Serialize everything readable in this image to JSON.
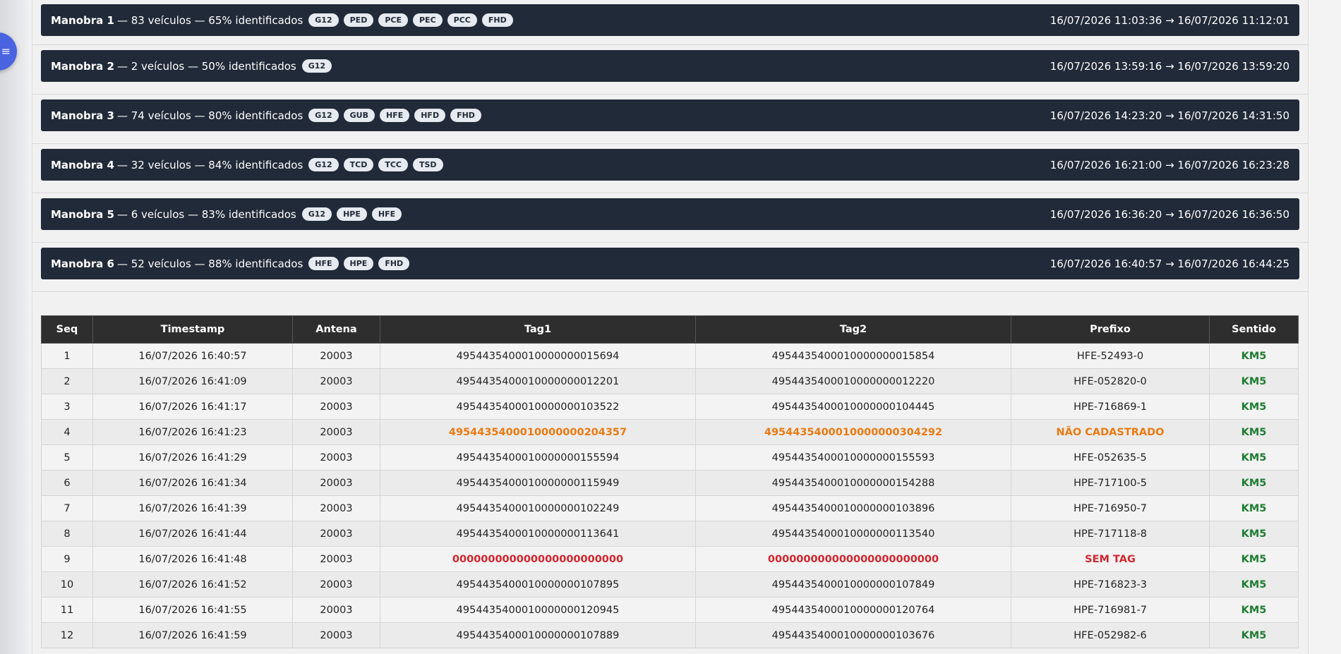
{
  "fab": {
    "icon": "menu-icon",
    "glyph": "≡"
  },
  "manobras": [
    {
      "name": "Manobra 1",
      "info": "— 83 veículos — 65% identificados",
      "tags": [
        "G12",
        "PED",
        "PCE",
        "PEC",
        "PCC",
        "FHD"
      ],
      "period": "16/07/2026 11:03:36 → 16/07/2026 11:12:01"
    },
    {
      "name": "Manobra 2",
      "info": "— 2 veículos — 50% identificados",
      "tags": [
        "G12"
      ],
      "period": "16/07/2026 13:59:16 → 16/07/2026 13:59:20"
    },
    {
      "name": "Manobra 3",
      "info": "— 74 veículos — 80% identificados",
      "tags": [
        "G12",
        "GUB",
        "HFE",
        "HFD",
        "FHD"
      ],
      "period": "16/07/2026 14:23:20 → 16/07/2026 14:31:50"
    },
    {
      "name": "Manobra 4",
      "info": "— 32 veículos — 84% identificados",
      "tags": [
        "G12",
        "TCD",
        "TCC",
        "TSD"
      ],
      "period": "16/07/2026 16:21:00 → 16/07/2026 16:23:28"
    },
    {
      "name": "Manobra 5",
      "info": "— 6 veículos — 83% identificados",
      "tags": [
        "G12",
        "HPE",
        "HFE"
      ],
      "period": "16/07/2026 16:36:20 → 16/07/2026 16:36:50"
    },
    {
      "name": "Manobra 6",
      "info": "— 52 veículos — 88% identificados",
      "tags": [
        "HFE",
        "HPE",
        "FHD"
      ],
      "period": "16/07/2026 16:40:57 → 16/07/2026 16:44:25"
    }
  ],
  "table": {
    "headers": [
      "Seq",
      "Timestamp",
      "Antena",
      "Tag1",
      "Tag2",
      "Prefixo",
      "Sentido"
    ],
    "rows": [
      {
        "seq": "1",
        "timestamp": "16/07/2026 16:40:57",
        "antena": "20003",
        "tag1": "4954435400010000000015694",
        "tag2": "4954435400010000000015854",
        "prefixo": "HFE-52493-0",
        "sentido": "KM5",
        "status": "ok"
      },
      {
        "seq": "2",
        "timestamp": "16/07/2026 16:41:09",
        "antena": "20003",
        "tag1": "4954435400010000000012201",
        "tag2": "4954435400010000000012220",
        "prefixo": "HFE-052820-0",
        "sentido": "KM5",
        "status": "ok"
      },
      {
        "seq": "3",
        "timestamp": "16/07/2026 16:41:17",
        "antena": "20003",
        "tag1": "4954435400010000000103522",
        "tag2": "4954435400010000000104445",
        "prefixo": "HPE-716869-1",
        "sentido": "KM5",
        "status": "ok"
      },
      {
        "seq": "4",
        "timestamp": "16/07/2026 16:41:23",
        "antena": "20003",
        "tag1": "4954435400010000000204357",
        "tag2": "4954435400010000000304292",
        "prefixo": "NÃO CADASTRADO",
        "sentido": "KM5",
        "status": "warn"
      },
      {
        "seq": "5",
        "timestamp": "16/07/2026 16:41:29",
        "antena": "20003",
        "tag1": "4954435400010000000155594",
        "tag2": "4954435400010000000155593",
        "prefixo": "HFE-052635-5",
        "sentido": "KM5",
        "status": "ok"
      },
      {
        "seq": "6",
        "timestamp": "16/07/2026 16:41:34",
        "antena": "20003",
        "tag1": "4954435400010000000115949",
        "tag2": "4954435400010000000154288",
        "prefixo": "HPE-717100-5",
        "sentido": "KM5",
        "status": "ok"
      },
      {
        "seq": "7",
        "timestamp": "16/07/2026 16:41:39",
        "antena": "20003",
        "tag1": "4954435400010000000102249",
        "tag2": "4954435400010000000103896",
        "prefixo": "HPE-716950-7",
        "sentido": "KM5",
        "status": "ok"
      },
      {
        "seq": "8",
        "timestamp": "16/07/2026 16:41:44",
        "antena": "20003",
        "tag1": "4954435400010000000113641",
        "tag2": "4954435400010000000113540",
        "prefixo": "HPE-717118-8",
        "sentido": "KM5",
        "status": "ok"
      },
      {
        "seq": "9",
        "timestamp": "16/07/2026 16:41:48",
        "antena": "20003",
        "tag1": "000000000000000000000000",
        "tag2": "000000000000000000000000",
        "prefixo": "SEM TAG",
        "sentido": "KM5",
        "status": "err"
      },
      {
        "seq": "10",
        "timestamp": "16/07/2026 16:41:52",
        "antena": "20003",
        "tag1": "4954435400010000000107895",
        "tag2": "4954435400010000000107849",
        "prefixo": "HPE-716823-3",
        "sentido": "KM5",
        "status": "ok"
      },
      {
        "seq": "11",
        "timestamp": "16/07/2026 16:41:55",
        "antena": "20003",
        "tag1": "4954435400010000000120945",
        "tag2": "4954435400010000000120764",
        "prefixo": "HPE-716981-7",
        "sentido": "KM5",
        "status": "ok"
      },
      {
        "seq": "12",
        "timestamp": "16/07/2026 16:41:59",
        "antena": "20003",
        "tag1": "4954435400010000000107889",
        "tag2": "4954435400010000000103676",
        "prefixo": "HFE-052982-6",
        "sentido": "KM5",
        "status": "ok"
      }
    ]
  },
  "colors": {
    "bar": "#212a38",
    "fab": "#4a63e0",
    "sentido": "#1e7d32",
    "warn": "#ea7a10",
    "err": "#d0262e",
    "header": "#2e2e2e"
  }
}
